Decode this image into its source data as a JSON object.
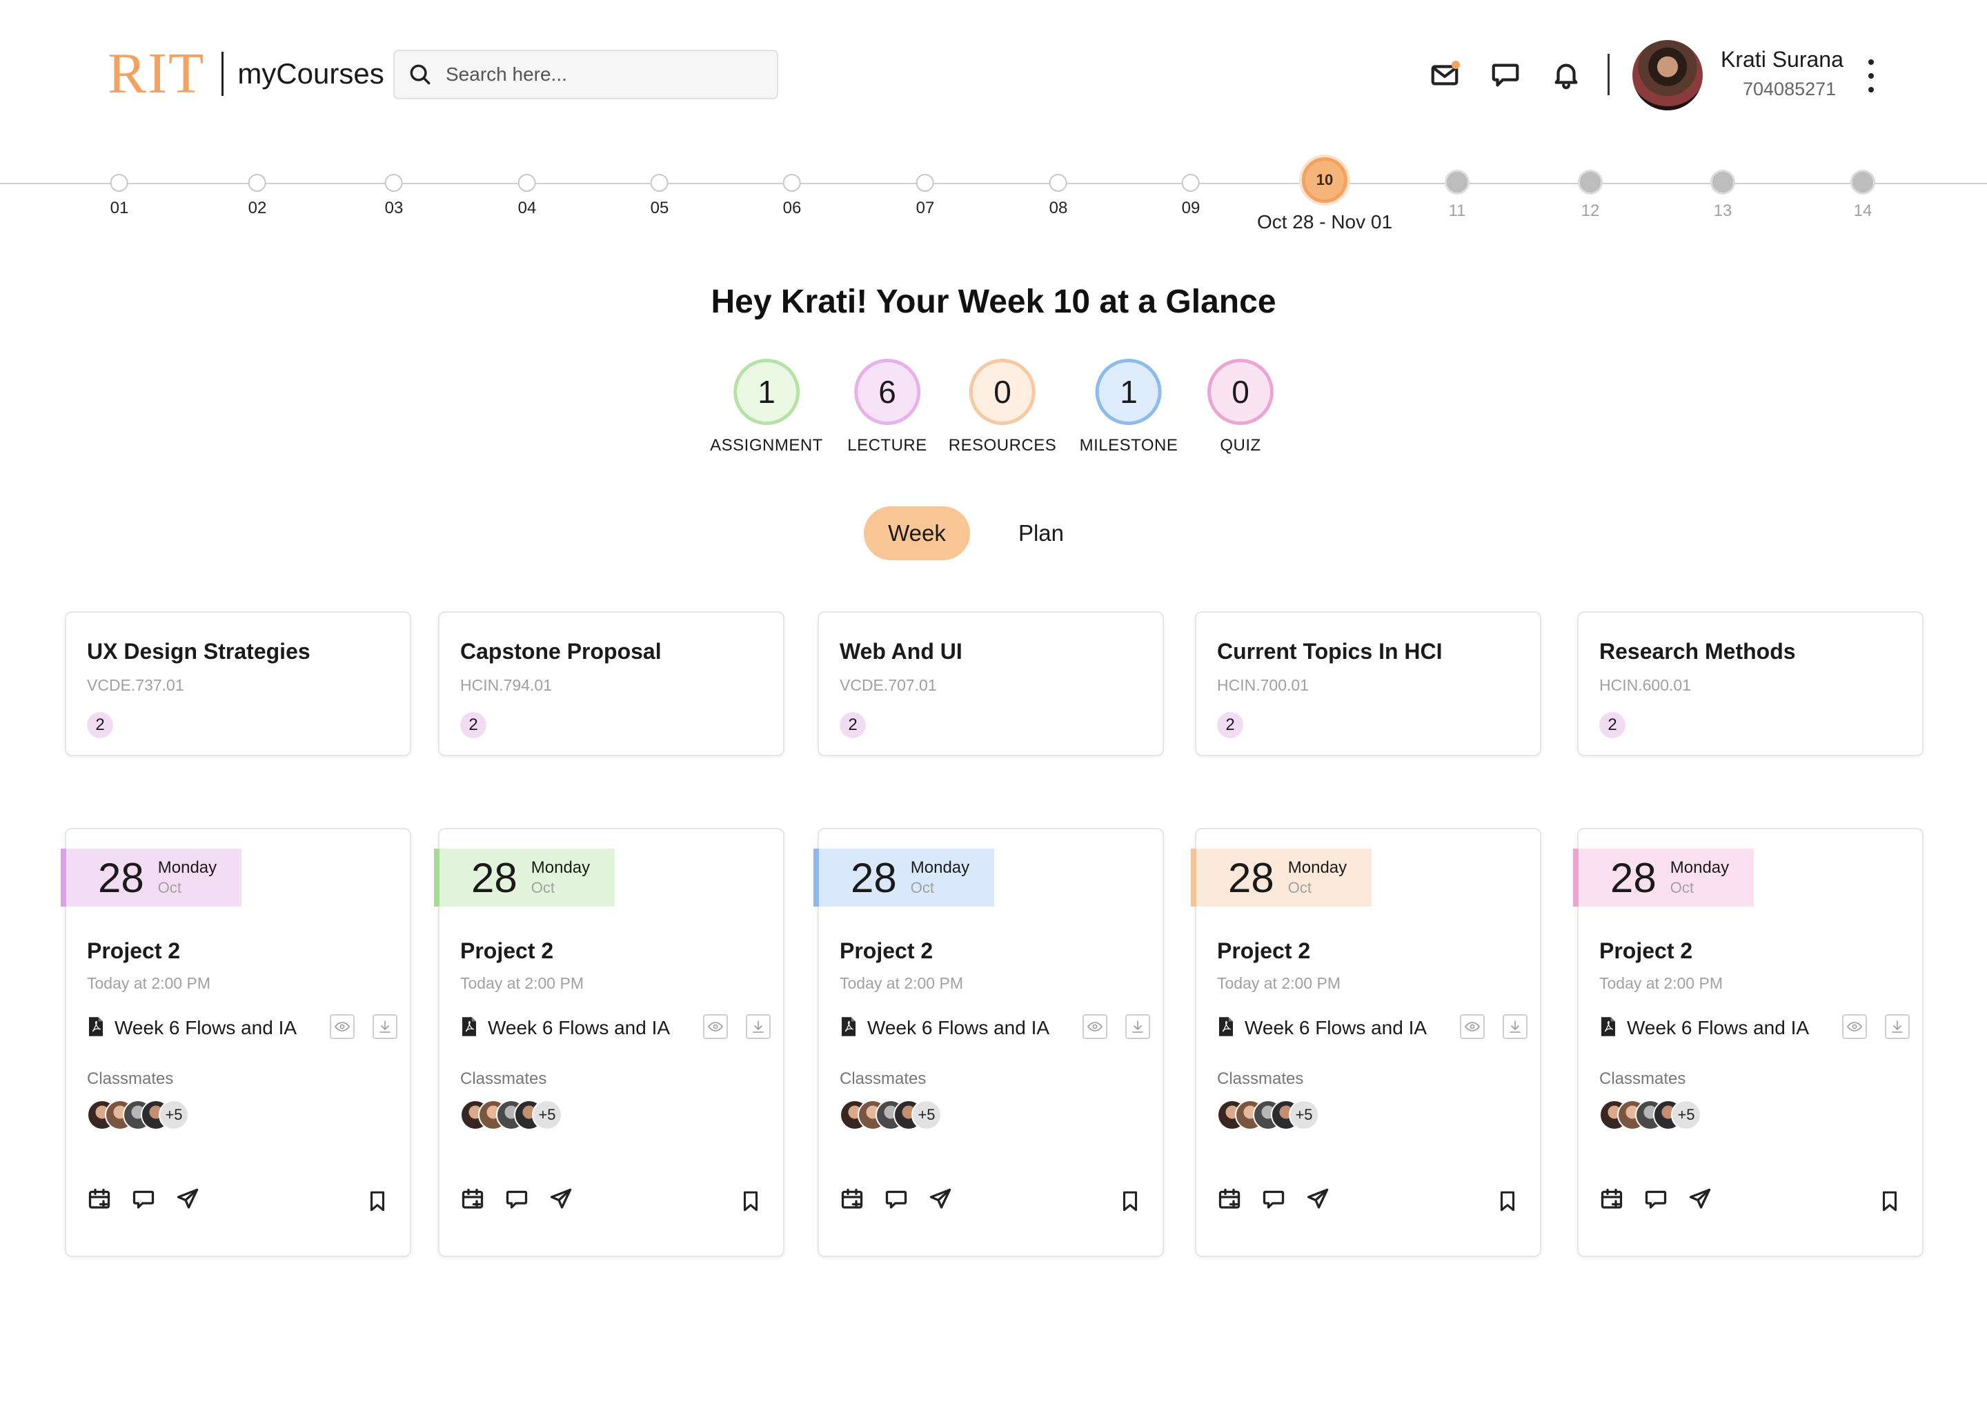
{
  "header": {
    "logo_brand": "RIT",
    "logo_app": "myCourses",
    "search_placeholder": "Search here...",
    "user_name": "Krati Surana",
    "user_id": "704085271",
    "colors": {
      "accent": "#F4A261",
      "notification_dot": "#F4A261"
    },
    "icons": [
      "mail-icon",
      "chat-icon",
      "bell-icon",
      "more-vertical-icon"
    ]
  },
  "timeline": {
    "weeks": [
      "01",
      "02",
      "03",
      "04",
      "05",
      "06",
      "07",
      "08",
      "09",
      "10",
      "11",
      "12",
      "13",
      "14"
    ],
    "current_week": "10",
    "current_range": "Oct 28 - Nov 01"
  },
  "glance": {
    "title": "Hey Krati! Your Week 10 at a Glance",
    "stats": [
      {
        "value": "1",
        "label": "ASSIGNMENT",
        "border": "#B6E2A6",
        "fill": "#E9F7E3"
      },
      {
        "value": "6",
        "label": "LECTURE",
        "border": "#E7B1EC",
        "fill": "#F7E3F8"
      },
      {
        "value": "0",
        "label": "RESOURCES",
        "border": "#F7C9A3",
        "fill": "#FDEEE2"
      },
      {
        "value": "1",
        "label": "MILESTONE",
        "border": "#8DBBEE",
        "fill": "#DDEBFB"
      },
      {
        "value": "0",
        "label": "QUIZ",
        "border": "#EDA6D4",
        "fill": "#FBE4F2"
      }
    ]
  },
  "view_toggle": {
    "week": "Week",
    "plan": "Plan",
    "active": "Week"
  },
  "courses": [
    {
      "title": "UX Design Strategies",
      "code": "VCDE.737.01",
      "count": "2"
    },
    {
      "title": "Capstone Proposal",
      "code": "HCIN.794.01",
      "count": "2"
    },
    {
      "title": "Web And UI",
      "code": "VCDE.707.01",
      "count": "2"
    },
    {
      "title": "Current Topics In HCI",
      "code": "HCIN.700.01",
      "count": "2"
    },
    {
      "title": "Research Methods",
      "code": "HCIN.600.01",
      "count": "2"
    }
  ],
  "tasks": [
    {
      "day": "28",
      "weekday": "Monday",
      "month": "Oct",
      "title": "Project 2",
      "time": "Today at 2:00 PM",
      "file": "Week 6 Flows and IA",
      "classmates_label": "Classmates",
      "more": "+5",
      "tag_bg": "#F2DDF5",
      "tag_border": "#D9A3E2"
    },
    {
      "day": "28",
      "weekday": "Monday",
      "month": "Oct",
      "title": "Project 2",
      "time": "Today at 2:00 PM",
      "file": "Week 6 Flows and IA",
      "classmates_label": "Classmates",
      "more": "+5",
      "tag_bg": "#E3F4DC",
      "tag_border": "#A9DA96"
    },
    {
      "day": "28",
      "weekday": "Monday",
      "month": "Oct",
      "title": "Project 2",
      "time": "Today at 2:00 PM",
      "file": "Week 6 Flows and IA",
      "classmates_label": "Classmates",
      "more": "+5",
      "tag_bg": "#D9E8FA",
      "tag_border": "#8FB9EC"
    },
    {
      "day": "28",
      "weekday": "Monday",
      "month": "Oct",
      "title": "Project 2",
      "time": "Today at 2:00 PM",
      "file": "Week 6 Flows and IA",
      "classmates_label": "Classmates",
      "more": "+5",
      "tag_bg": "#FCE9DA",
      "tag_border": "#F5C397"
    },
    {
      "day": "28",
      "weekday": "Monday",
      "month": "Oct",
      "title": "Project 2",
      "time": "Today at 2:00 PM",
      "file": "Week 6 Flows and IA",
      "classmates_label": "Classmates",
      "more": "+5",
      "tag_bg": "#FBE1F0",
      "tag_border": "#EFA5D0"
    }
  ]
}
